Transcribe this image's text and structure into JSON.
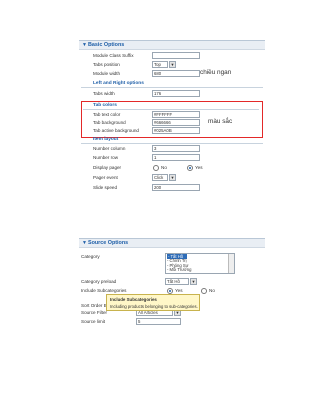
{
  "basic": {
    "title": "Basic Options",
    "rows": {
      "class_suffix": "Module Class Suffix",
      "tabs_position": "Tabs position",
      "tabs_position_value": "Top",
      "module_width": "Module width",
      "module_width_value": "680",
      "tabs_width": "Tabs width",
      "tabs_width_value": "176",
      "tab_text_color": "Tab text color",
      "tab_text_color_value": "#FFFFFF",
      "tab_background": "Tab background",
      "tab_background_value": "#666666",
      "tab_active_background": "Tab active background",
      "tab_active_background_value": "#025A0B",
      "number_column": "Number column",
      "number_column_value": "3",
      "number_row": "Number row",
      "number_row_value": "1",
      "display_pager": "Display pager",
      "no": "No",
      "yes": "Yes",
      "pager_event": "Pager event",
      "pager_event_value": "Click",
      "slide_speed": "Slide speed",
      "slide_speed_value": "200"
    },
    "subsections": {
      "left_right": "Left and Right options",
      "tab_colors": "Tab colors",
      "item_layout": "Item layout"
    },
    "annotations": {
      "width_note": "chiều ngan",
      "color_note": "màu sắc"
    }
  },
  "source": {
    "title": "Source Options",
    "category": "Category",
    "category_items": [
      "- Tất Hồ",
      "- Chính Trị",
      "- Phóng Sự",
      "- Mỗi Trường"
    ],
    "category_preload": "Category preload",
    "category_preload_value": "Tất Hồ",
    "include_subcategories": "Include Subcategories",
    "yes": "Yes",
    "no": "No",
    "sort_order_by": "Sort Order By",
    "source_filter": "Source Filter",
    "source_filter_value": "All Articles",
    "source_limit": "Source limit",
    "source_limit_value": "5",
    "tooltip_title": "Include Subcategories",
    "tooltip_text": "Including products belonging to sub-categories."
  },
  "colors": {
    "accent": "#1f5fa8",
    "highlight_box": "#e32929"
  }
}
